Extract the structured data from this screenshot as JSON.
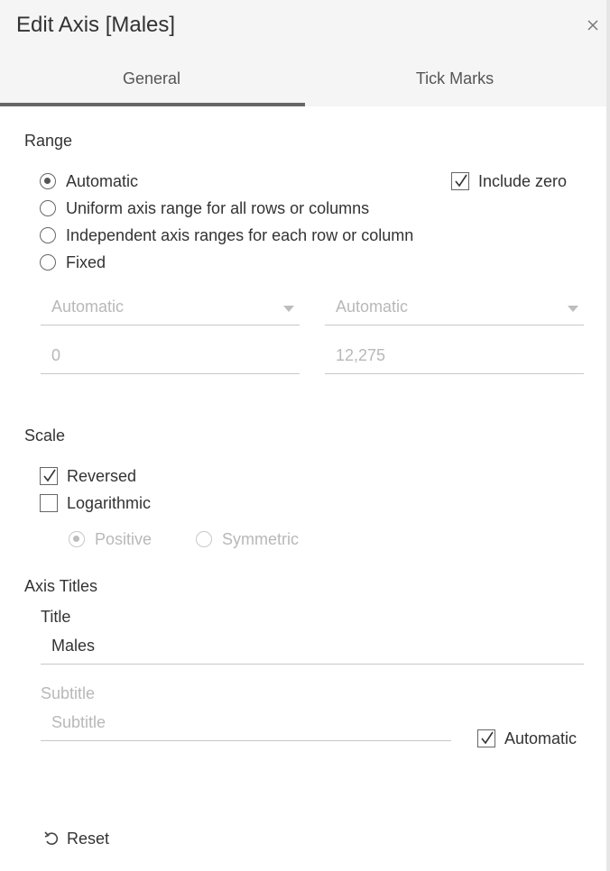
{
  "dialog": {
    "title": "Edit Axis [Males]",
    "close_icon": "close-icon"
  },
  "tabs": [
    {
      "label": "General",
      "active": true
    },
    {
      "label": "Tick Marks",
      "active": false
    }
  ],
  "range": {
    "heading": "Range",
    "options": [
      {
        "label": "Automatic",
        "checked": true
      },
      {
        "label": "Uniform axis range for all rows or columns",
        "checked": false
      },
      {
        "label": "Independent axis ranges for each row or column",
        "checked": false
      },
      {
        "label": "Fixed",
        "checked": false
      }
    ],
    "include_zero": {
      "label": "Include zero",
      "checked": true
    },
    "start_dropdown": "Automatic",
    "end_dropdown": "Automatic",
    "start_value": "0",
    "end_value": "12,275"
  },
  "scale": {
    "heading": "Scale",
    "reversed": {
      "label": "Reversed",
      "checked": true
    },
    "logarithmic": {
      "label": "Logarithmic",
      "checked": false
    },
    "positive": {
      "label": "Positive",
      "checked": true,
      "disabled": true
    },
    "symmetric": {
      "label": "Symmetric",
      "checked": false,
      "disabled": true
    }
  },
  "axis_titles": {
    "heading": "Axis Titles",
    "title_label": "Title",
    "title_value": "Males",
    "subtitle_label": "Subtitle",
    "subtitle_placeholder": "Subtitle",
    "automatic": {
      "label": "Automatic",
      "checked": true
    }
  },
  "footer": {
    "reset_label": "Reset",
    "reset_icon": "undo-icon"
  },
  "colors": {
    "tab_underline": "#666666",
    "header_bg": "#f5f5f5",
    "disabled_text": "#b8b8b8"
  }
}
